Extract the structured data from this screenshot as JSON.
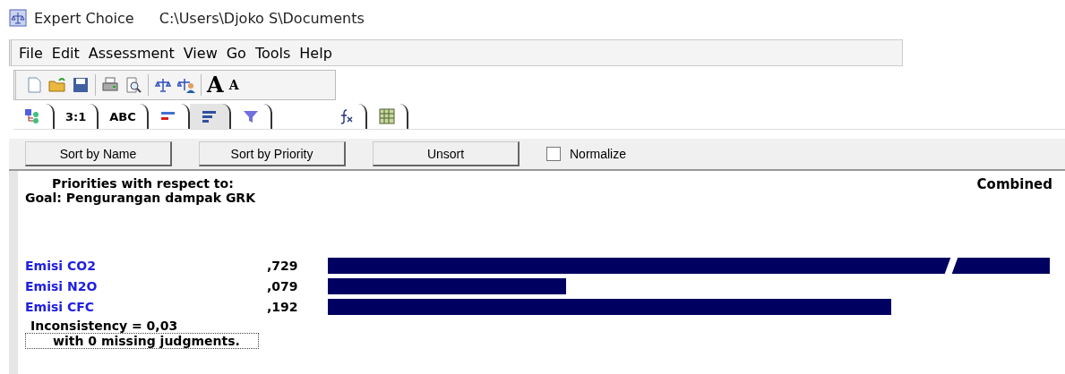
{
  "window": {
    "title": "Expert Choice",
    "path": "C:\\Users\\Djoko S\\Documents"
  },
  "menu": [
    "File",
    "Edit",
    "Assessment",
    "View",
    "Go",
    "Tools",
    "Help"
  ],
  "toolbar": {
    "font_larger": "A",
    "font_smaller": "A"
  },
  "tab_groups": [
    [
      {
        "kind": "icon",
        "selected": false
      },
      {
        "kind": "text",
        "label": "3:1",
        "selected": false
      },
      {
        "kind": "text",
        "label": "ABC",
        "selected": false
      },
      {
        "kind": "icon",
        "selected": false
      },
      {
        "kind": "icon",
        "selected": true
      },
      {
        "kind": "icon",
        "selected": false
      }
    ],
    [
      {
        "kind": "icon",
        "selected": false
      },
      {
        "kind": "icon",
        "selected": false
      }
    ]
  ],
  "buttons": [
    "Sort by Name",
    "Sort by Priority",
    "Unsort"
  ],
  "normalize": {
    "label": "Normalize",
    "checked": false
  },
  "report": {
    "heading": "Priorities with respect to:",
    "goal": "Goal: Pengurangan dampak GRK",
    "mode": "Combined",
    "rows": [
      {
        "name": "Emisi CO2",
        "value": ",729"
      },
      {
        "name": "Emisi N2O",
        "value": ",079"
      },
      {
        "name": "Emisi CFC",
        "value": ",192"
      }
    ],
    "inconsistency": "Inconsistency = 0,03",
    "missing": "with 0  missing judgments."
  }
}
